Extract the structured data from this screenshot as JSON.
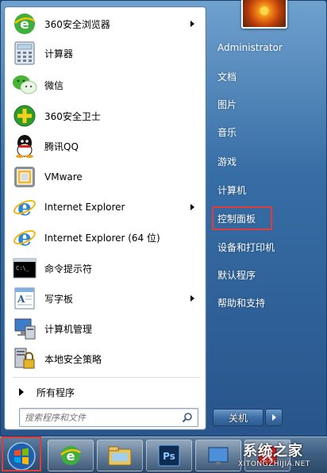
{
  "programs": [
    {
      "label": "360安全浏览器",
      "icon": "360-browser-icon",
      "has_submenu": true
    },
    {
      "label": "计算器",
      "icon": "calculator-icon",
      "has_submenu": false
    },
    {
      "label": "微信",
      "icon": "wechat-icon",
      "has_submenu": false
    },
    {
      "label": "360安全卫士",
      "icon": "360-safeguard-icon",
      "has_submenu": false
    },
    {
      "label": "腾讯QQ",
      "icon": "qq-icon",
      "has_submenu": false
    },
    {
      "label": "VMware",
      "icon": "vmware-icon",
      "has_submenu": false
    },
    {
      "label": "Internet Explorer",
      "icon": "ie-icon",
      "has_submenu": true
    },
    {
      "label": "Internet Explorer (64 位)",
      "icon": "ie-icon",
      "has_submenu": false
    },
    {
      "label": "命令提示符",
      "icon": "cmd-icon",
      "has_submenu": false
    },
    {
      "label": "写字板",
      "icon": "wordpad-icon",
      "has_submenu": true
    },
    {
      "label": "计算机管理",
      "icon": "computer-management-icon",
      "has_submenu": false
    },
    {
      "label": "本地安全策略",
      "icon": "local-security-policy-icon",
      "has_submenu": false
    }
  ],
  "all_programs_label": "所有程序",
  "search": {
    "placeholder": "搜索程序和文件"
  },
  "right_links": [
    {
      "label": "Administrator"
    },
    {
      "label": "文档"
    },
    {
      "label": "图片"
    },
    {
      "label": "音乐"
    },
    {
      "label": "游戏"
    },
    {
      "label": "计算机"
    },
    {
      "label": "控制面板"
    },
    {
      "label": "设备和打印机"
    },
    {
      "label": "默认程序"
    },
    {
      "label": "帮助和支持"
    }
  ],
  "shutdown_label": "关机",
  "taskbar": [
    "start-orb-icon",
    "360-browser-icon",
    "file-explorer-icon",
    "photoshop-icon",
    "windows-icon",
    "red-app-icon"
  ],
  "watermark": {
    "text": "系统之家",
    "url": "XITONGZHIJIA.NET"
  },
  "colors": {
    "highlight": "#e23b3b",
    "panel_blue": "#2b6aa4"
  }
}
